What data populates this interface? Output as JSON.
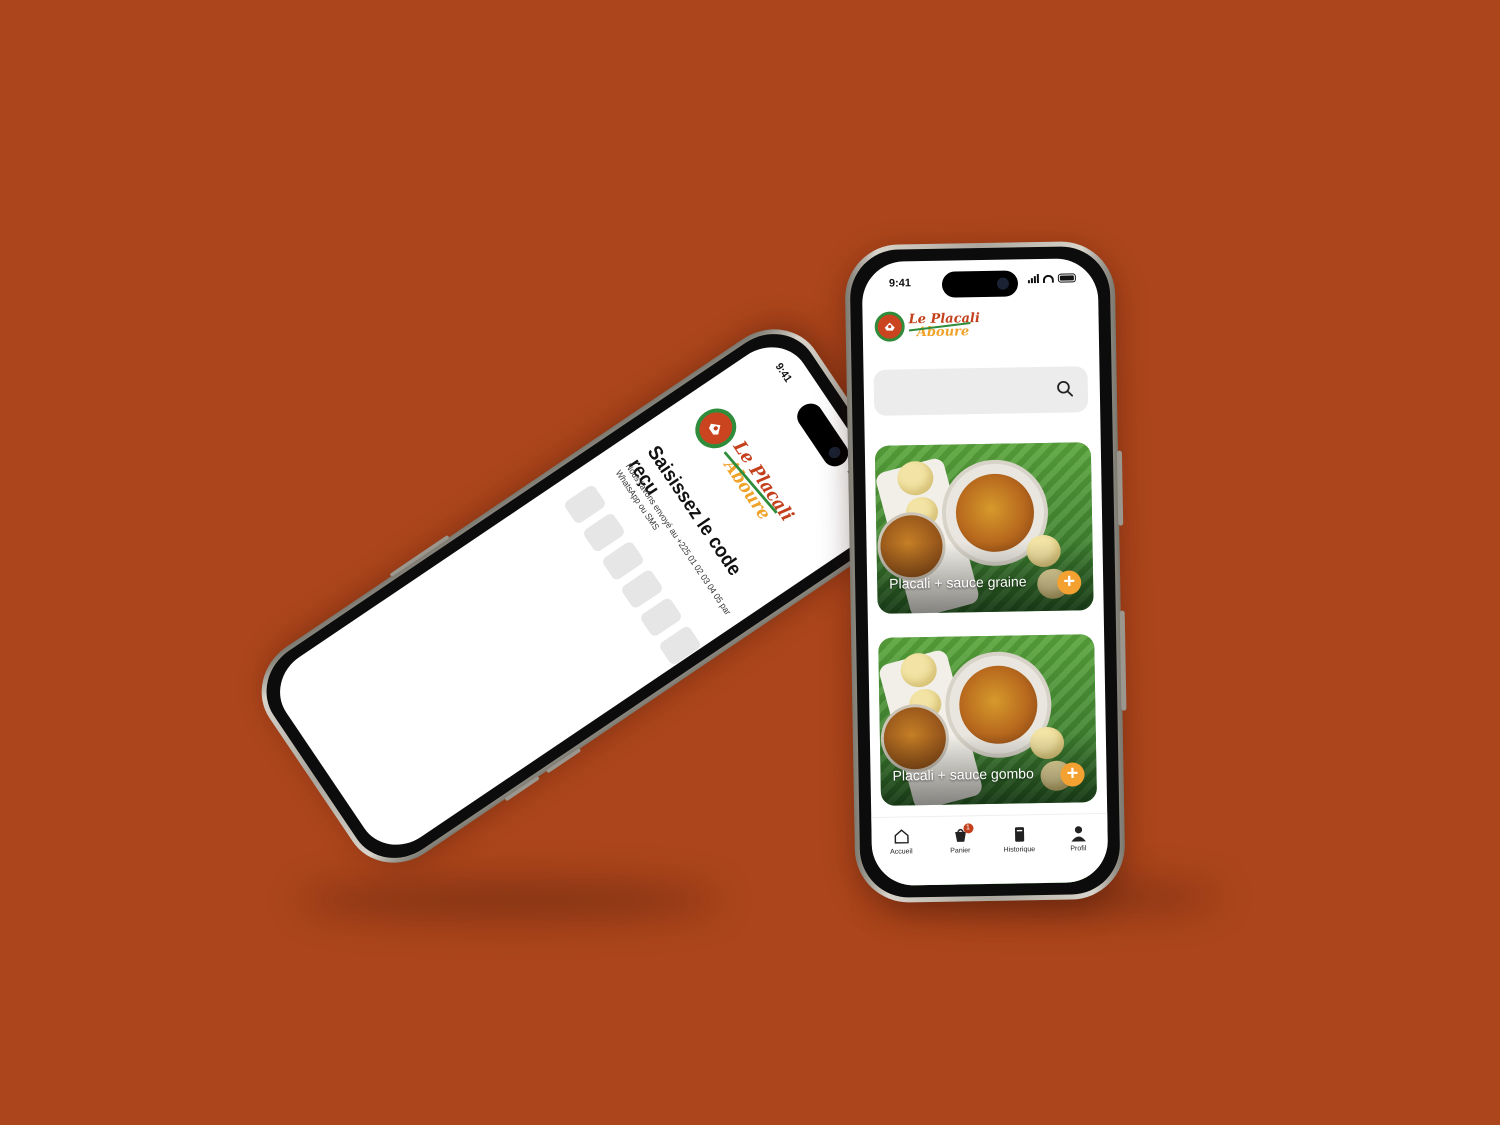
{
  "background_color": "#ac451b",
  "brand": {
    "line1": "Le Placali",
    "line2": "Aboure",
    "colors": {
      "red": "#c4401c",
      "orange": "#f0a32a",
      "green": "#2f8c3a"
    }
  },
  "left_phone": {
    "status_time": "9:41",
    "title": "Saisissez le code reçu",
    "subtitle": "Nous l'avons envoyé au +225 01 02 03 04 05 par WhatsApp ou SMS",
    "otp_box_count": 6
  },
  "right_phone": {
    "status_time": "9:41",
    "search": {
      "icon": "search-icon"
    },
    "products": [
      {
        "name": "Placali + sauce graine",
        "add_icon": "+"
      },
      {
        "name": "Placali + sauce gombo",
        "add_icon": "+"
      }
    ],
    "tabs": [
      {
        "label": "Accueil",
        "icon": "home-icon"
      },
      {
        "label": "Panier",
        "icon": "cart-icon",
        "badge": "1"
      },
      {
        "label": "Historique",
        "icon": "history-icon"
      },
      {
        "label": "Profil",
        "icon": "profile-icon"
      }
    ]
  }
}
